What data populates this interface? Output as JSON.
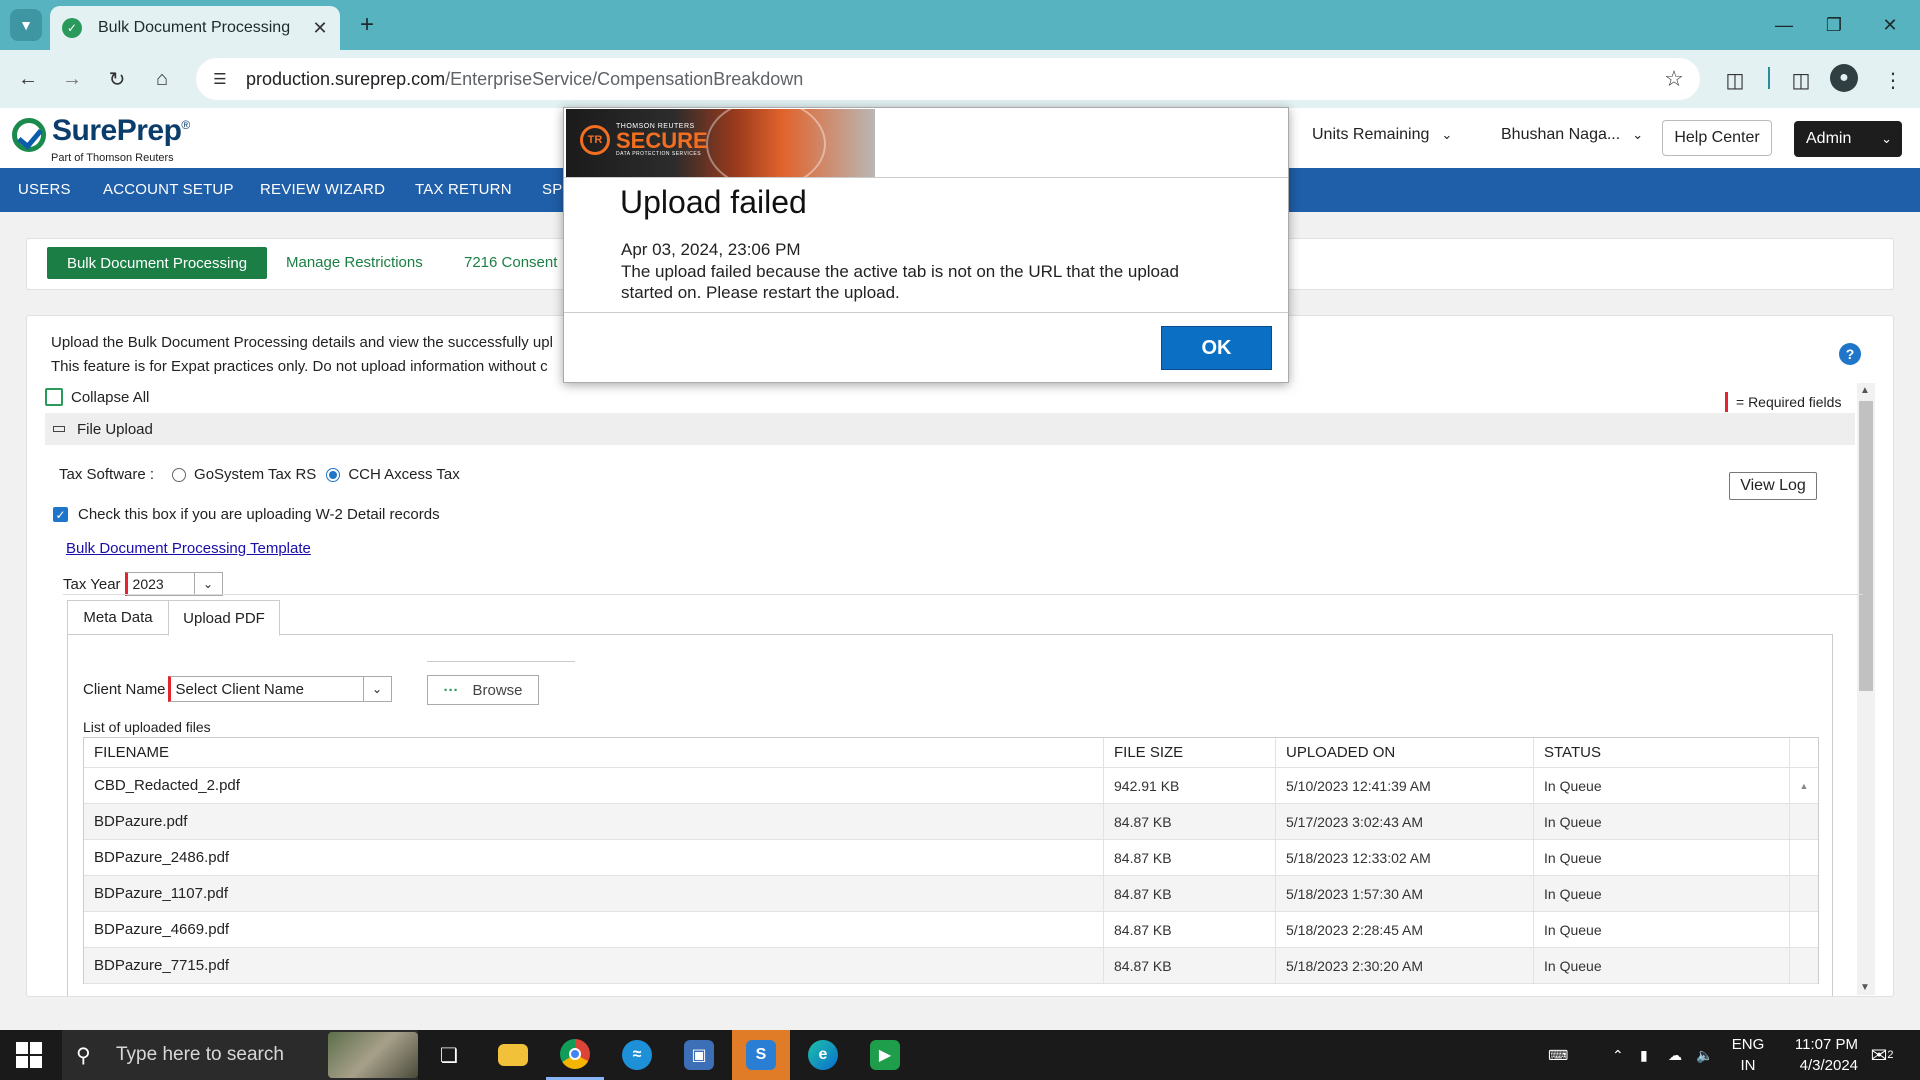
{
  "browser": {
    "tab_title": "Bulk Document Processing",
    "url_host": "production.sureprep.com",
    "url_path": "/EnterpriseService/CompensationBreakdown"
  },
  "header": {
    "logo_text": "SurePrep",
    "logo_registered": "®",
    "logo_subtitle": "Part of Thomson Reuters",
    "units_remaining": "Units Remaining",
    "user_name": "Bhushan Naga...",
    "help_center": "Help Center",
    "admin": "Admin"
  },
  "main_nav": [
    "USERS",
    "ACCOUNT SETUP",
    "REVIEW WIZARD",
    "TAX RETURN",
    "SPI"
  ],
  "sub_nav": {
    "active": "Bulk Document Processing",
    "links": [
      "Manage Restrictions",
      "7216 Consent"
    ]
  },
  "panel": {
    "intro_line1": "Upload the Bulk Document Processing details and view the successfully upl",
    "intro_line2": "This feature is for Expat practices only. Do not upload information without c",
    "collapse_all": "Collapse All",
    "required_note": "= Required fields",
    "section_title": "File Upload",
    "tax_software_label": "Tax Software :",
    "tax_software_options": [
      "GoSystem Tax RS",
      "CCH Axcess Tax"
    ],
    "tax_software_selected": "CCH Axcess Tax",
    "view_log": "View Log",
    "w2_check_label": "Check this box if you are uploading W-2 Detail records",
    "w2_checked": true,
    "template_link": "Bulk Document Processing Template",
    "tax_year_label": "Tax Year",
    "tax_year_value": "2023",
    "tabs": [
      "Meta Data",
      "Upload PDF"
    ],
    "active_tab": "Upload PDF",
    "client_name_label": "Client Name",
    "client_name_placeholder": "Select Client Name",
    "browse": "Browse",
    "uploaded_label": "List of uploaded files"
  },
  "files_table": {
    "columns": [
      "FILENAME",
      "FILE SIZE",
      "UPLOADED ON",
      "STATUS"
    ],
    "rows": [
      [
        "CBD_Redacted_2.pdf",
        "942.91 KB",
        "5/10/2023 12:41:39 AM",
        "In Queue"
      ],
      [
        "BDPazure.pdf",
        "84.87 KB",
        "5/17/2023 3:02:43 AM",
        "In Queue"
      ],
      [
        "BDPazure_2486.pdf",
        "84.87 KB",
        "5/18/2023 12:33:02 AM",
        "In Queue"
      ],
      [
        "BDPazure_1107.pdf",
        "84.87 KB",
        "5/18/2023 1:57:30 AM",
        "In Queue"
      ],
      [
        "BDPazure_4669.pdf",
        "84.87 KB",
        "5/18/2023 2:28:45 AM",
        "In Queue"
      ],
      [
        "BDPazure_7715.pdf",
        "84.87 KB",
        "5/18/2023 2:30:20 AM",
        "In Queue"
      ]
    ]
  },
  "modal": {
    "banner_small": "THOMSON REUTERS",
    "banner_big": "SECURE",
    "banner_sub": "DATA PROTECTION SERVICES",
    "banner_badge": "TR",
    "title": "Upload failed",
    "timestamp": "Apr 03, 2024, 23:06 PM",
    "message": "The upload failed because the active tab is not on the URL that the upload started on. Please restart the upload.",
    "ok": "OK"
  },
  "taskbar": {
    "search_placeholder": "Type here to search",
    "lang_line1": "ENG",
    "lang_line2": "IN",
    "time": "11:07 PM",
    "date": "4/3/2024",
    "notif_count": "2"
  },
  "colors": {
    "tabstrip": "#57b3c0",
    "nav_blue": "#1f5ea8",
    "brand_green": "#1b7f45",
    "ok_blue": "#0b70c4",
    "required_red": "#e3262b"
  }
}
